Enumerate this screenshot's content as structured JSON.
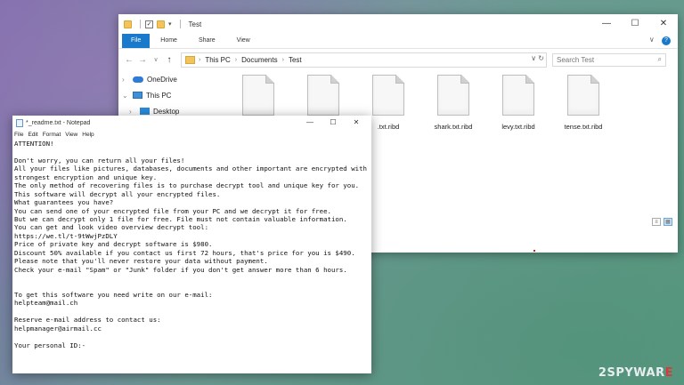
{
  "explorer": {
    "title": "Test",
    "qa_arrow": "▾",
    "controls": {
      "minimize": "—",
      "maximize": "☐",
      "close": "✕"
    },
    "tabs": [
      {
        "label": "File"
      },
      {
        "label": "Home"
      },
      {
        "label": "Share"
      },
      {
        "label": "View"
      }
    ],
    "ribbon_chevron": "∨",
    "help": "?",
    "nav_arrows": {
      "back": "←",
      "forward": "→",
      "down": "∨",
      "up": "↑"
    },
    "breadcrumb": [
      {
        "label": "This PC"
      },
      {
        "label": "Documents"
      },
      {
        "label": "Test"
      }
    ],
    "crumb_separator": "›",
    "address_tail": "∨  ↻",
    "search_placeholder": "Search Test",
    "search_icon": "⌕",
    "nav_items": [
      {
        "label": "OneDrive",
        "icon": "cloud-icon"
      },
      {
        "label": "This PC",
        "icon": "computer-icon"
      },
      {
        "label": "Desktop",
        "icon": "desktop-icon"
      }
    ],
    "nav_chevron": "›",
    "files": [
      {
        "name": ""
      },
      {
        "name": ""
      },
      {
        "name": ".txt.ribd"
      },
      {
        "name": "shark.txt.ribd"
      },
      {
        "name": "levy.txt.ribd"
      },
      {
        "name": "tense.txt.ribd"
      }
    ],
    "view_buttons": [
      "≡",
      "▦"
    ]
  },
  "notepad": {
    "title": "*_readme.txt - Notepad",
    "controls": {
      "minimize": "—",
      "maximize": "☐",
      "close": "✕"
    },
    "menu": [
      "File",
      "Edit",
      "Format",
      "View",
      "Help"
    ],
    "lines": [
      "ATTENTION!",
      "",
      "Don't worry, you can return all your files!",
      "All your files like pictures, databases, documents and other important are encrypted with",
      "strongest encryption and unique key.",
      "The only method of recovering files is to purchase decrypt tool and unique key for you.",
      "This software will decrypt all your encrypted files.",
      "What guarantees you have?",
      "You can send one of your encrypted file from your PC and we decrypt it for free.",
      "But we can decrypt only 1 file for free. File must not contain valuable information.",
      "You can get and look video overview decrypt tool:",
      "https://we.tl/t-9tWwjPzDLY",
      "Price of private key and decrypt software is $980.",
      "Discount 50% available if you contact us first 72 hours, that's price for you is $490.",
      "Please note that you'll never restore your data without payment.",
      "Check your e-mail \"Spam\" or \"Junk\" folder if you don't get answer more than 6 hours.",
      "",
      "",
      "To get this software you need write on our e-mail:",
      "helpteam@mail.ch",
      "",
      "Reserve e-mail address to contact us:",
      "helpmanager@airmail.cc",
      "",
      "Your personal ID:-"
    ]
  },
  "watermark": {
    "prefix": "2SPYWAR",
    "accent": "E"
  }
}
